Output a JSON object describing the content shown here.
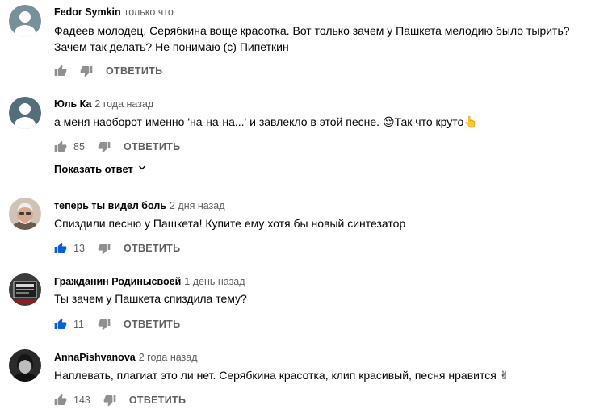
{
  "comments": [
    {
      "author": "Fedor Symkin",
      "time": "только что",
      "text_line1": "Фадеев молодец, Серябкина воще красотка. Вот только зачем у Пашкета мелодию было тырить?",
      "text_line2": "Зачем так делать? Не понимаю (с) Пипеткин",
      "likes": "",
      "reply_label": "ОТВЕТИТЬ",
      "like_active": false,
      "avatar_icon": "default-avatar-icon",
      "avatar_color": "#78909c"
    },
    {
      "author": "Юль Ка",
      "time": "2 года назад",
      "text_line1": "а меня наоборот именно 'на-на-на...' и завлекло в этой песне. 😌Так что круто👆",
      "likes": "85",
      "reply_label": "ОТВЕТИТЬ",
      "show_replies_label": "Показать ответ",
      "like_active": false,
      "avatar_icon": "default-avatar-icon",
      "avatar_color": "#546e7a"
    },
    {
      "author": "теперь ты видел боль",
      "time": "2 дня назад",
      "text_line1": "Спиздили песню у Пашкета! Купите ему хотя бы новый синтезатор",
      "likes": "13",
      "reply_label": "ОТВЕТИТЬ",
      "like_active": true,
      "avatar_icon": "photo-avatar-old-man"
    },
    {
      "author": "Гражданин Родиныcвоей",
      "time": "1 день назад",
      "text_line1": "Ты зачем у Пашкета спиздила тему?",
      "likes": "11",
      "reply_label": "ОТВЕТИТЬ",
      "like_active": true,
      "avatar_icon": "photo-avatar-badge"
    },
    {
      "author": "AnnaPishvanova",
      "time": "2 года назад",
      "text_line1": "Наплевать, плагиат это ли нет. Серябкина красотка, клип красивый, песня нравится ✌",
      "likes": "143",
      "reply_label": "ОТВЕТИТЬ",
      "like_active": false,
      "avatar_icon": "photo-avatar-dark"
    }
  ],
  "colors": {
    "like_active": "#065fd4",
    "icon_inactive": "#909090",
    "secondary_text": "#606060"
  }
}
